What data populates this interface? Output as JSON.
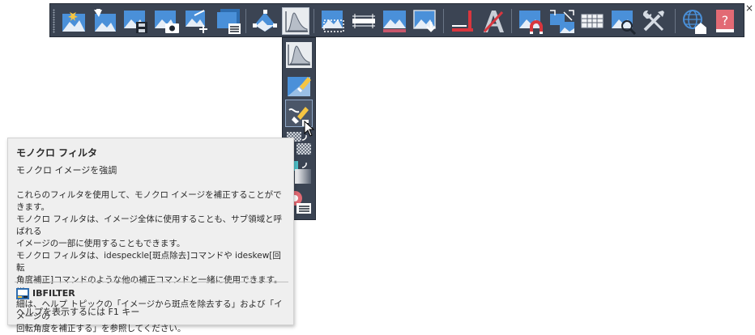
{
  "toolbar": {
    "close_glyph": "×",
    "buttons": [
      {
        "icon": "image-burst-icon"
      },
      {
        "icon": "image-insert-icon"
      },
      {
        "icon": "image-save-icon"
      },
      {
        "icon": "image-camera-icon"
      },
      {
        "icon": "image-move-icon"
      },
      {
        "icon": "image-list-icon"
      },
      {
        "icon": "image-transform-icon"
      },
      {
        "icon": "histogram-flyout-icon"
      },
      {
        "icon": "image-crop-icon"
      },
      {
        "icon": "image-line-icon"
      },
      {
        "icon": "image-bar-icon"
      },
      {
        "icon": "image-download-icon"
      },
      {
        "icon": "red-line-icon"
      },
      {
        "icon": "red-letter-a-icon"
      },
      {
        "icon": "image-magnet-icon"
      },
      {
        "icon": "image-split-icon"
      },
      {
        "icon": "grid-icon"
      },
      {
        "icon": "image-search-icon"
      },
      {
        "icon": "tools-icon"
      },
      {
        "icon": "globe-house-icon"
      },
      {
        "icon": "help-book-icon"
      }
    ]
  },
  "flyout": {
    "items": [
      {
        "icon": "histogram-icon"
      },
      {
        "icon": "image-erase-icon"
      },
      {
        "icon": "monochrome-filter-icon"
      },
      {
        "icon": "checker-pattern-icon"
      },
      {
        "icon": "gradient-icon"
      },
      {
        "icon": "settings-list-icon"
      }
    ]
  },
  "tooltip": {
    "title": "モノクロ フィルタ",
    "subtitle": "モノクロ イメージを強調",
    "body_lines": [
      "これらのフィルタを使用して、モノクロ イメージを補正することができます。",
      "モノクロ フィルタは、イメージ全体に使用することも、サブ領域と呼ばれる",
      "イメージの一部に使用することもできます。",
      "モノクロ フィルタは、idespeckle[斑点除去]コマンドや ideskew[回転",
      "角度補正]コマンドのような他の補正コマンドと一緒に使用できます。詳",
      "細は、ヘルプ トピックの「イメージから斑点を除去する」および「イメージの",
      "回転角度を補正する」を参照してください。"
    ],
    "command": "IBFILTER",
    "help_hint": "ヘルプを表示するには F1 キー"
  }
}
